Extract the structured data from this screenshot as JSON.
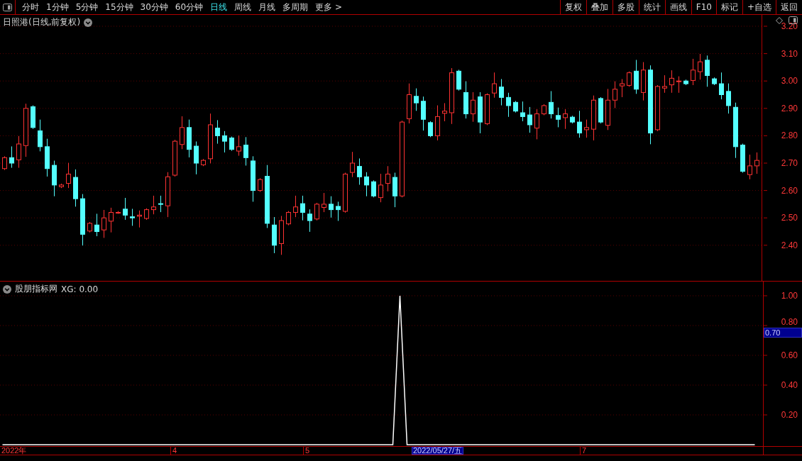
{
  "toolbar": {
    "periods": [
      {
        "label": "分时",
        "selected": false
      },
      {
        "label": "1分钟",
        "selected": false
      },
      {
        "label": "5分钟",
        "selected": false
      },
      {
        "label": "15分钟",
        "selected": false
      },
      {
        "label": "30分钟",
        "selected": false
      },
      {
        "label": "60分钟",
        "selected": false
      },
      {
        "label": "日线",
        "selected": true
      },
      {
        "label": "周线",
        "selected": false
      },
      {
        "label": "月线",
        "selected": false
      },
      {
        "label": "多周期",
        "selected": false
      },
      {
        "label": "更多 >",
        "selected": false
      }
    ],
    "actions": [
      "复权",
      "叠加",
      "多股",
      "统计",
      "画线",
      "F10",
      "标记",
      "+自选",
      "返回"
    ]
  },
  "price_pane": {
    "title": "日照港(日线,前复权)",
    "axis_labels": [
      "3.20",
      "3.10",
      "3.00",
      "2.90",
      "2.80",
      "2.70",
      "2.60",
      "2.50",
      "2.40"
    ]
  },
  "indicator_pane": {
    "name": "股朋指标网",
    "reading": ": 0.00",
    "crosshair_value": "0.70",
    "chart_data": {
      "type": "line",
      "grid": true,
      "ylim": [
        0,
        1.1
      ],
      "yticks": [
        {
          "value": 0.2,
          "label": "0.20"
        },
        {
          "value": 0.4,
          "label": "0.40"
        },
        {
          "value": 0.6,
          "label": "0.60"
        },
        {
          "value": 0.8,
          "label": "0.80"
        },
        {
          "value": 1.0,
          "label": "1.00"
        }
      ],
      "series": [
        {
          "name": "XG",
          "color": "#ffffff",
          "values": [
            0,
            0,
            0,
            0,
            0,
            0,
            0,
            0,
            0,
            0,
            0,
            0,
            0,
            0,
            0,
            0,
            0,
            0,
            0,
            0,
            0,
            0,
            0,
            0,
            0,
            0,
            0,
            0,
            0,
            0,
            0,
            0,
            0,
            0,
            0,
            0,
            0,
            0,
            0,
            0,
            0,
            0,
            0,
            0,
            0,
            0,
            0,
            0,
            0,
            0,
            0,
            0,
            0,
            0,
            0,
            0,
            1,
            0,
            0,
            0,
            0,
            0,
            0,
            0,
            0,
            0,
            0,
            0,
            0,
            0,
            0,
            0,
            0,
            0,
            0,
            0,
            0,
            0,
            0,
            0,
            0,
            0,
            0,
            0,
            0,
            0,
            0,
            0,
            0,
            0,
            0,
            0,
            0,
            0,
            0,
            0,
            0,
            0,
            0,
            0,
            0,
            0,
            0,
            0,
            0,
            0,
            0
          ]
        }
      ]
    }
  },
  "date_axis": {
    "labels": [
      "2022年",
      "4",
      "5",
      "7"
    ],
    "crosshair_date": "2022/05/27/五"
  }
}
